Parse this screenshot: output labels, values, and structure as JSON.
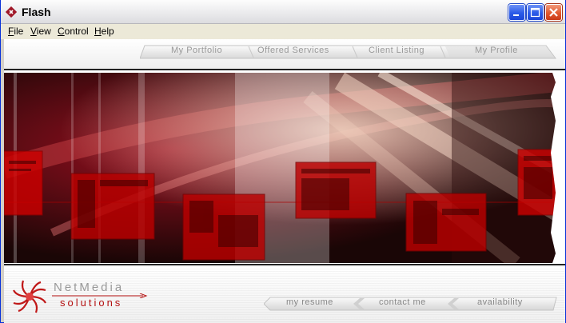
{
  "window": {
    "title": "Flash"
  },
  "menu": [
    {
      "label": "File",
      "accel": "F",
      "rest": "ile"
    },
    {
      "label": "View",
      "accel": "V",
      "rest": "iew"
    },
    {
      "label": "Control",
      "accel": "C",
      "rest": "ontrol"
    },
    {
      "label": "Help",
      "accel": "H",
      "rest": "elp"
    }
  ],
  "nav": {
    "tabs": [
      "My Portfolio",
      "Offered Services",
      "Client Listing",
      "My Profile"
    ]
  },
  "logo": {
    "line1": "NetMedia",
    "line2": "solutions"
  },
  "footer_links": [
    "my resume",
    "contact me",
    "availability"
  ],
  "colors": {
    "accent_red": "#b41010",
    "titlebar_blue": "#2a5ae8",
    "close_red": "#e1582e"
  },
  "icons": [
    "flash-app-icon",
    "minimize-icon",
    "maximize-icon",
    "close-icon",
    "netmedia-swirl-logo"
  ]
}
